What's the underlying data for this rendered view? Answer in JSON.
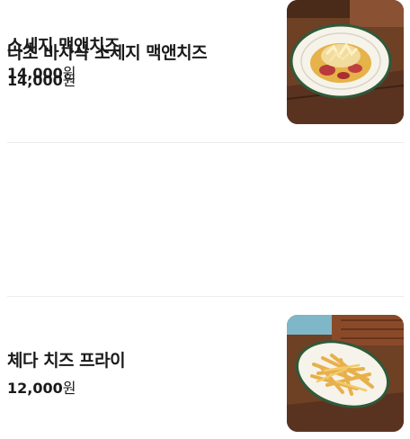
{
  "menu": {
    "items": [
      {
        "name": "나초 바사삭 소세지 맥앤치즈",
        "price": "14,000",
        "currency": "원",
        "photo_icon": "mac-and-cheese-photo"
      },
      {
        "name": "체다 치즈 프라이",
        "price": "12,000",
        "currency": "원",
        "photo_icon": "cheese-fries-photo"
      },
      {
        "name": "소세지 맥앤치즈",
        "price": "14,000",
        "currency": "원",
        "photo_icon": "mac-and-cheese-photo"
      }
    ]
  },
  "colors": {
    "text": "#1a1a1a",
    "divider": "#ececec",
    "table_wood": "#7a4a2a",
    "plate_rim": "#2f5a3a",
    "fries": "#e8b04a"
  }
}
